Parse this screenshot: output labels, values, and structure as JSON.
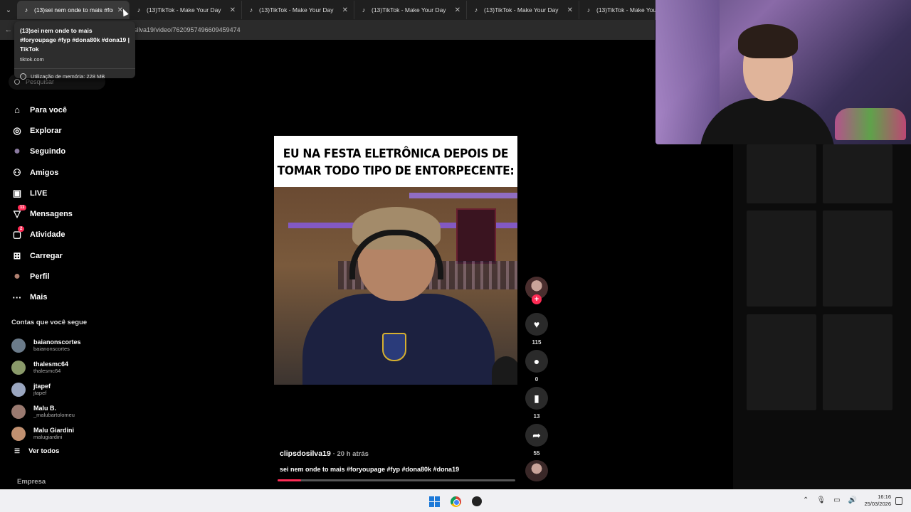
{
  "browser": {
    "tabs": [
      {
        "title": "(13)sei nem onde to mais #fory",
        "active": true
      },
      {
        "title": "(13)TikTok - Make Your Day",
        "active": false
      },
      {
        "title": "(13)TikTok - Make Your Day",
        "active": false
      },
      {
        "title": "(13)TikTok - Make Your Day",
        "active": false
      },
      {
        "title": "(13)TikTok - Make Your Day",
        "active": false
      },
      {
        "title": "(13)TikTok - Make Your Day",
        "active": false
      }
    ],
    "url": "silva19/video/7620957496609459474",
    "tooltip": {
      "title": "(13)sei nem onde to mais #foryoupage #fyp #dona80k #dona19 | TikTok",
      "domain": "tiktok.com",
      "memory": "Utilização de memória: 228 MB"
    }
  },
  "sidebar": {
    "search_placeholder": "Pesquisar",
    "nav": [
      {
        "label": "Para você",
        "icon": "home-icon",
        "glyph": "⌂",
        "badge": ""
      },
      {
        "label": "Explorar",
        "icon": "compass-icon",
        "glyph": "◎",
        "badge": ""
      },
      {
        "label": "Seguindo",
        "icon": "following-avatar-icon",
        "glyph": "●",
        "badge": ""
      },
      {
        "label": "Amigos",
        "icon": "friends-icon",
        "glyph": "⚇",
        "badge": ""
      },
      {
        "label": "LIVE",
        "icon": "live-tv-icon",
        "glyph": "▣",
        "badge": ""
      },
      {
        "label": "Mensagens",
        "icon": "messages-icon",
        "glyph": "▽",
        "badge": "11"
      },
      {
        "label": "Atividade",
        "icon": "activity-icon",
        "glyph": "▢",
        "badge": "2"
      },
      {
        "label": "Carregar",
        "icon": "upload-icon",
        "glyph": "⊞",
        "badge": ""
      },
      {
        "label": "Perfil",
        "icon": "profile-avatar-icon",
        "glyph": "●",
        "badge": ""
      },
      {
        "label": "Mais",
        "icon": "more-icon",
        "glyph": "···",
        "badge": ""
      }
    ],
    "following_title": "Contas que você segue",
    "accounts": [
      {
        "name": "baianonscortes",
        "handle": "baianonscortes",
        "color": "#6b7b8a"
      },
      {
        "name": "thalesmc64",
        "handle": "thalesmc64",
        "color": "#8a9a6a"
      },
      {
        "name": "jtapef",
        "handle": "jtapef",
        "color": "#9aa6c0"
      },
      {
        "name": "Malu B.",
        "handle": "_malubartolomeu",
        "color": "#9a7a70"
      },
      {
        "name": "Malu Giardini",
        "handle": "malugiardini",
        "color": "#c09070"
      }
    ],
    "see_all": "Ver todos",
    "company": "Empresa"
  },
  "video": {
    "caption_line1": "EU NA FESTA ELETRÔNICA DEPOIS DE",
    "caption_line2": "TOMAR TODO TIPO DE ENTORPECENTE:",
    "author": "clipsdosilva19",
    "time": "· 20 h atrás",
    "description": "sei nem onde to mais #foryoupage #fyp #dona80k #dona19",
    "progress_percent": 10
  },
  "actions": {
    "likes": "115",
    "comments": "0",
    "saves": "13",
    "shares": "55"
  },
  "taskbar": {
    "time": "16:16",
    "date": "25/03/2026"
  },
  "colors": {
    "accent": "#fe2c55",
    "background": "#000000"
  }
}
